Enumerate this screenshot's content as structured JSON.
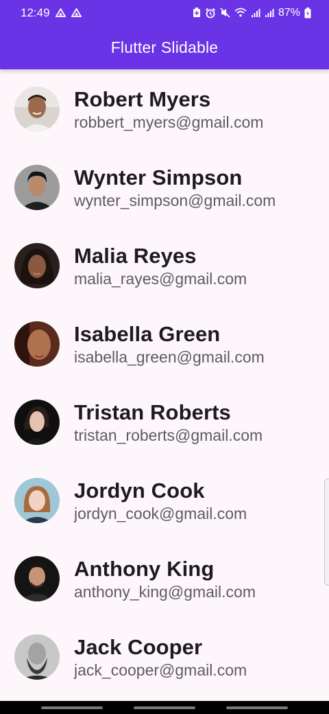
{
  "status_bar": {
    "time": "12:49",
    "battery": "87%",
    "icons": [
      "drive-icon",
      "drive-icon",
      "battery-saver-icon",
      "alarm-icon",
      "mute-icon",
      "wifi-icon",
      "signal-icon",
      "signal-icon",
      "battery-icon"
    ]
  },
  "app_bar": {
    "title": "Flutter Slidable",
    "color": "#6a33e6"
  },
  "contacts": [
    {
      "name": "Robert Myers",
      "email": "robbert_myers@gmail.com",
      "avatar": "avatar-robert"
    },
    {
      "name": "Wynter Simpson",
      "email": "wynter_simpson@gmail.com",
      "avatar": "avatar-wynter"
    },
    {
      "name": "Malia Reyes",
      "email": "malia_rayes@gmail.com",
      "avatar": "avatar-malia"
    },
    {
      "name": "Isabella Green",
      "email": "isabella_green@gmail.com",
      "avatar": "avatar-isabella"
    },
    {
      "name": "Tristan Roberts",
      "email": "tristan_roberts@gmail.com",
      "avatar": "avatar-tristan"
    },
    {
      "name": "Jordyn Cook",
      "email": "jordyn_cook@gmail.com",
      "avatar": "avatar-jordyn"
    },
    {
      "name": "Anthony King",
      "email": "anthony_king@gmail.com",
      "avatar": "avatar-anthony"
    },
    {
      "name": "Jack Cooper",
      "email": "jack_cooper@gmail.com",
      "avatar": "avatar-jack"
    }
  ]
}
